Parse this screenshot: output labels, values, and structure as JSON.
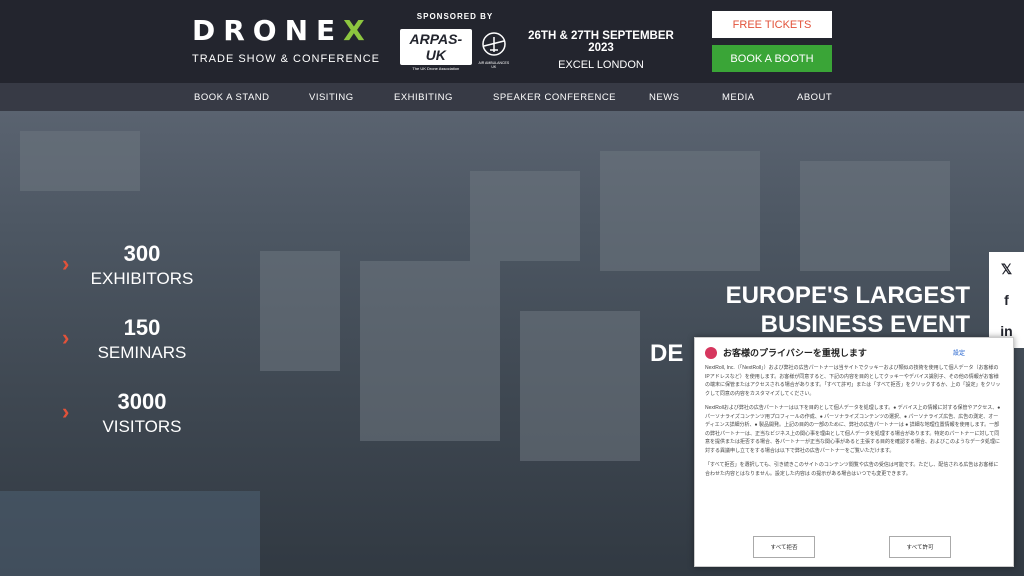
{
  "header": {
    "logo_text": "DRONE",
    "logo_x": "X",
    "logo_sub": "TRADE SHOW & CONFERENCE",
    "sponsor_label": "SPONSORED BY",
    "sponsor_logo": "ARPAS-UK",
    "sponsor_logo_sub": "The UK Drone Association",
    "sponsor_logo2_sub": "AIR AMBULANCES UK",
    "date": "26TH & 27TH SEPTEMBER 2023",
    "venue": "EXCEL LONDON",
    "free_tickets": "FREE TICKETS",
    "book_booth": "BOOK A BOOTH"
  },
  "nav": {
    "items": [
      "BOOK A STAND",
      "VISITING",
      "EXHIBITING",
      "SPEAKER CONFERENCE",
      "NEWS",
      "MEDIA",
      "ABOUT"
    ]
  },
  "hero": {
    "stats": [
      {
        "num": "300",
        "label": "EXHIBITORS"
      },
      {
        "num": "150",
        "label": "SEMINARS"
      },
      {
        "num": "3000",
        "label": "VISITORS"
      }
    ],
    "headline": [
      "EUROPE'S LARGEST",
      "BUSINESS EVENT",
      "DE"
    ],
    "arrow": "›"
  },
  "social": {
    "items": [
      {
        "icon": "twitter-icon",
        "glyph": "𝕏"
      },
      {
        "icon": "facebook-icon",
        "glyph": "f"
      },
      {
        "icon": "linkedin-icon",
        "glyph": "in"
      }
    ]
  },
  "privacy": {
    "title": "お客様のプライバシーを重視します",
    "settings": "設定",
    "p1": "NextRoll, Inc.（「NextRoll」）および弊社の広告パートナーは当サイトでクッキーおよび類似の技術を使用して個人データ（お客様のIPアドレスなど）を使用します。お客様が同意すると、下記の内容を目的としてクッキーやデバイス識別子、その他の情報がお客様の端末に保管またはアクセスされる場合があります。「すべて許可」または「すべて拒否」をクリックするか、上の「設定」をクリックして同意の内容をカスタマイズしてください。",
    "p2": "NextRollおよび弊社の広告パートナーは以下を目的として個人データを処理します。● デバイス上の情報に対する保管やアクセス、● パーソナライズコンテンツ用プロフィールの作成、● パーソナライズコンテンツの選択、● パーソナライズ広告、広告の測定、オーディエンス詳細分析、● 製品開発。上記の目的の一部のために、弊社の広告パートナーは ● 詳細な地理位置情報を使用します。一部の弊社パートナーは、正当なビジネス上の関心事を理由として個人データを処理する場合があります。特定のパートナーに対して同意を提供または拒否する場合、各パートナーが正当な関心事があると主張する目的を確認する場合、およびこのようなデータ処理に対する異議申し立てをする場合は以下で弊社の広告パートナーをご覧いただけます。",
    "p3": "「すべて拒否」を選択しても、引き続きこのサイトのコンテンツ閲覧や広告の受信は可能です。ただし、配信される広告はお客様に合わせた内容とはなりません。設定した内容は の提示がある場合はいつでも変更できます。",
    "reject": "すべて拒否",
    "accept": "すべて許可"
  }
}
